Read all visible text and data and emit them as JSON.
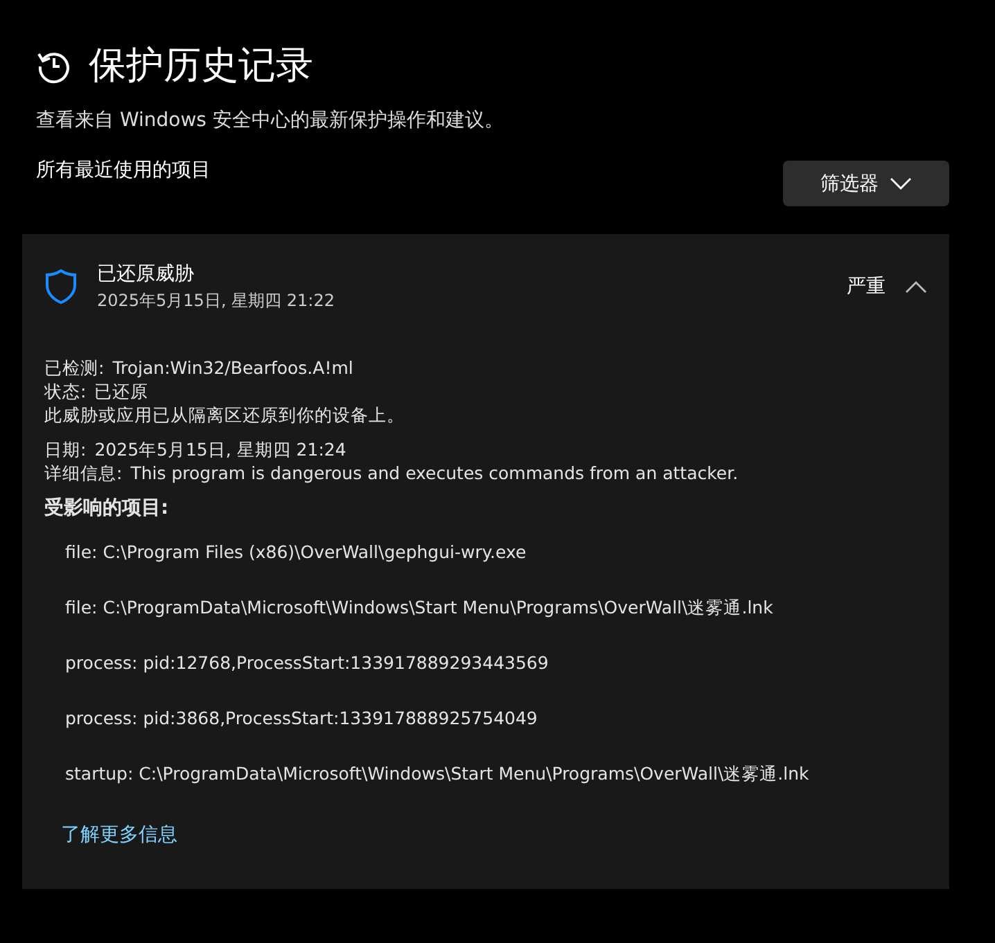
{
  "page": {
    "title": "保护历史记录",
    "subtitle": "查看来自 Windows 安全中心的最新保护操作和建议。",
    "section_label": "所有最近使用的项目",
    "filter_button": "筛选器"
  },
  "event": {
    "title": "已还原威胁",
    "timestamp": "2025年5月15日, 星期四 21:22",
    "severity": "严重",
    "expanded": true,
    "details": [
      {
        "label": "已检测:",
        "value": "Trojan:Win32/Bearfoos.A!ml"
      },
      {
        "label": "状态:",
        "value": "已还原"
      }
    ],
    "message": "此威胁或应用已从隔离区还原到你的设备上。",
    "details_2": [
      {
        "label": "日期:",
        "value": "2025年5月15日, 星期四 21:24"
      },
      {
        "label": "详细信息:",
        "value": "This program is dangerous and executes commands from an attacker."
      }
    ],
    "affected_heading": "受影响的项目:",
    "affected_items": [
      "file: C:\\Program Files (x86)\\OverWall\\gephgui-wry.exe",
      "file: C:\\ProgramData\\Microsoft\\Windows\\Start Menu\\Programs\\OverWall\\迷雾通.lnk",
      "process: pid:12768,ProcessStart:133917889293443569",
      "process: pid:3868,ProcessStart:133917888925754049",
      "startup: C:\\ProgramData\\Microsoft\\Windows\\Start Menu\\Programs\\OverWall\\迷雾通.lnk"
    ],
    "learn_more_link": "了解更多信息"
  }
}
